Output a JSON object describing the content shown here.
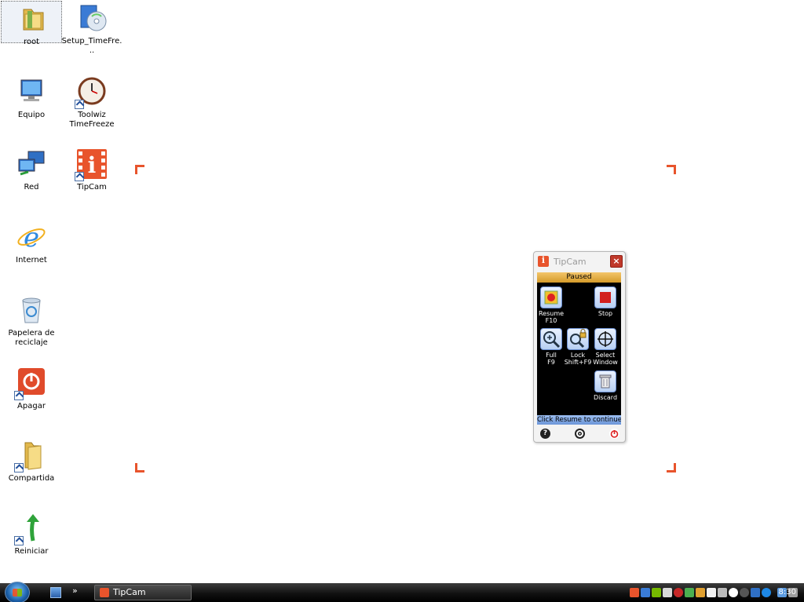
{
  "desktop": {
    "icons": [
      {
        "label": "root",
        "icon": "folder-icon"
      },
      {
        "label": "Setup_TimeFre...",
        "icon": "installer-icon"
      },
      {
        "label": "Equipo",
        "icon": "computer-icon"
      },
      {
        "label": "Toolwiz TimeFreeze",
        "icon": "clock-icon"
      },
      {
        "label": "Red",
        "icon": "network-icon"
      },
      {
        "label": "TipCam",
        "icon": "tipcam-icon"
      },
      {
        "label": "Internet",
        "icon": "internet-explorer-icon"
      },
      {
        "label": "Papelera de reciclaje",
        "icon": "recycle-bin-icon"
      },
      {
        "label": "Apagar",
        "icon": "power-icon"
      },
      {
        "label": "Compartida",
        "icon": "folder-icon"
      },
      {
        "label": "Reiniciar",
        "icon": "restart-arrow-icon"
      }
    ]
  },
  "tipcam": {
    "title": "TipCam",
    "close_label": "×",
    "status": "Paused",
    "buttons": {
      "resume": "Resume\nF10",
      "stop": "Stop",
      "full": "Full\nF9",
      "lock": "Lock\nShift+F9",
      "select": "Select\nWindow",
      "discard": "Discard"
    },
    "hint": "Click Resume to continue",
    "footer": {
      "help": "?",
      "settings": "gear-icon",
      "power": "power-icon"
    }
  },
  "taskbar": {
    "quick_launch_more": "»",
    "task_label": "TipCam",
    "clock": "8:30"
  },
  "colors": {
    "accent": "#e8542c",
    "status_bar": "#d49a2a",
    "hint_bar": "#6b95d8",
    "taskbar": "#111111"
  }
}
